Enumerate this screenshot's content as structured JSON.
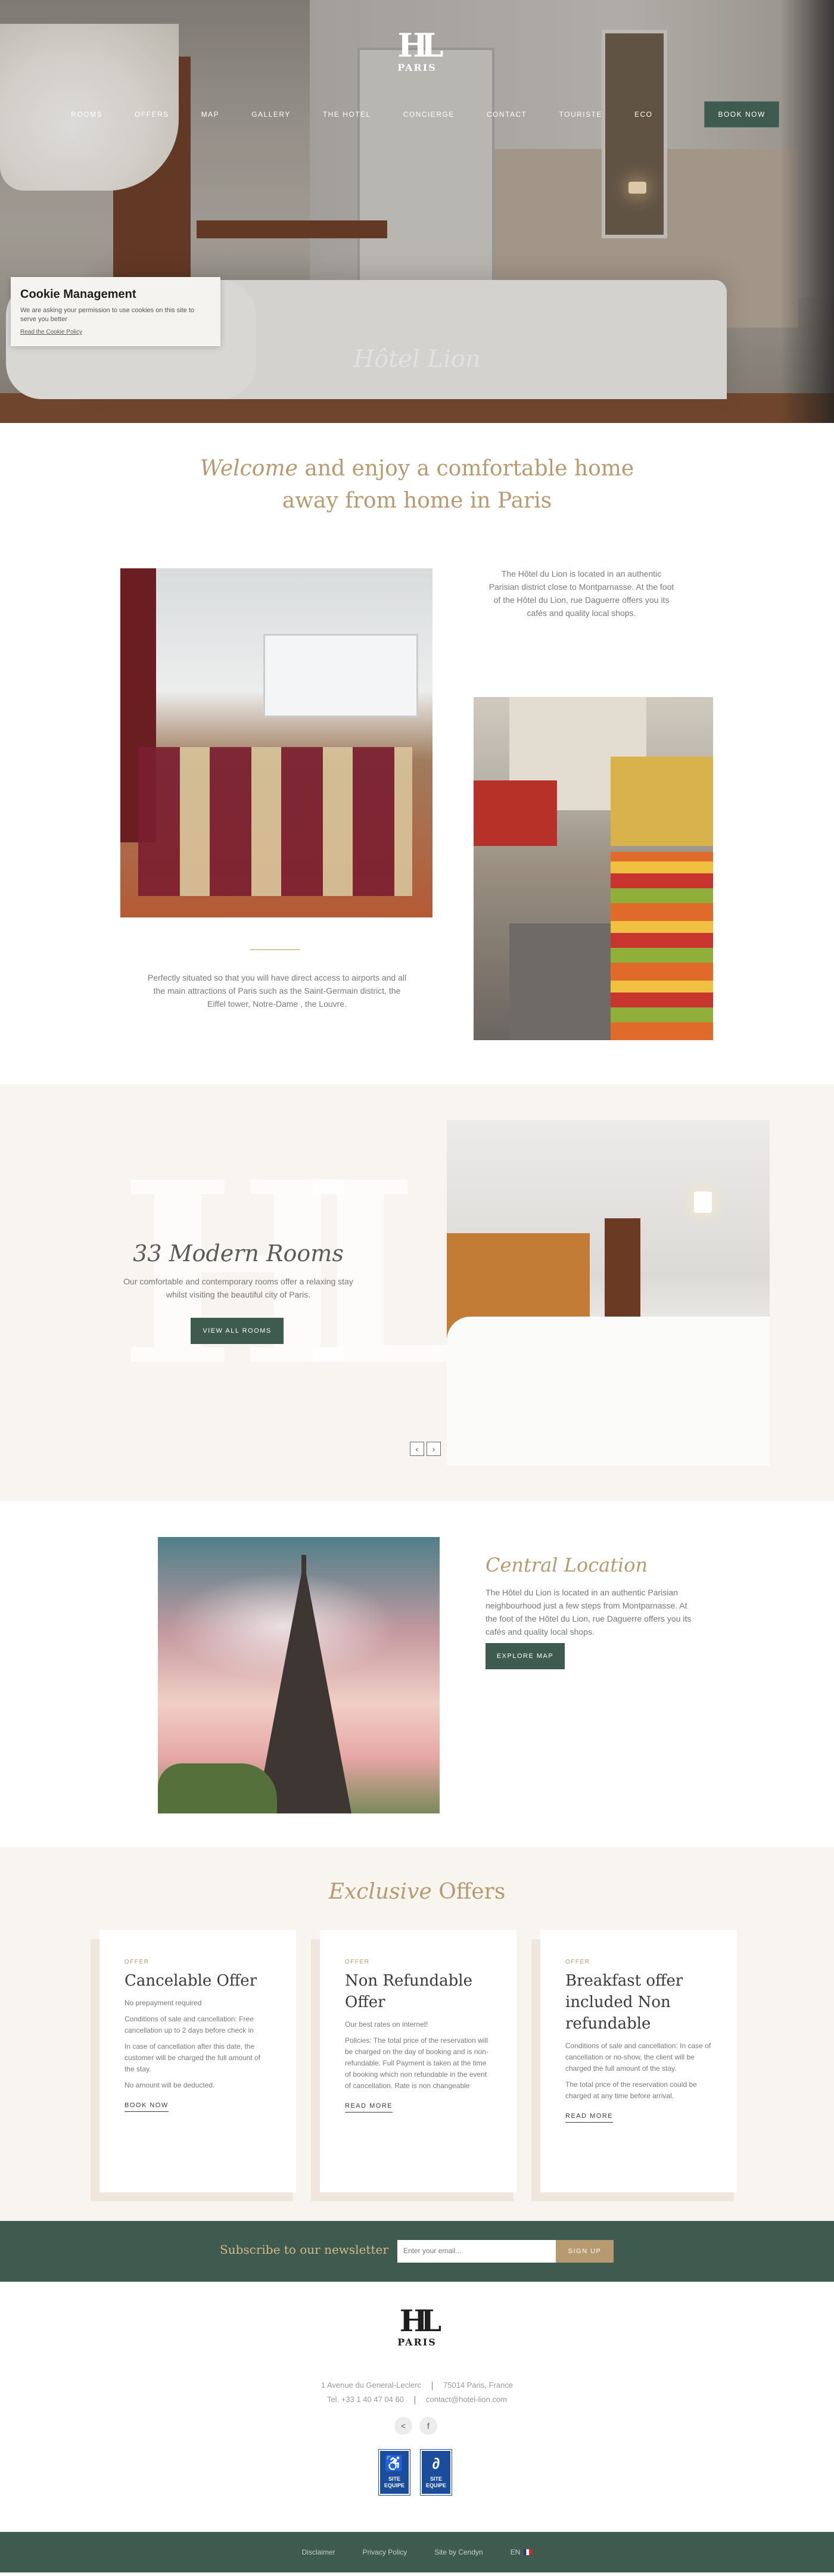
{
  "header": {
    "logo": {
      "mark": "HL",
      "city": "PARIS"
    },
    "nav": [
      "ROOMS",
      "OFFERS",
      "MAP",
      "GALLERY",
      "THE HOTEL",
      "CONCIERGE",
      "CONTACT",
      "TOURISTE",
      "ECO"
    ],
    "book_now": "BOOK NOW",
    "hero_title": "Hôtel Lion"
  },
  "cookie": {
    "title": "Cookie Management",
    "text": "We are asking your permission to use cookies on this site to serve you better",
    "link": "Read the Cookie Policy"
  },
  "welcome": {
    "italic": "Welcome",
    "rest_line1": " and enjoy a comfortable home",
    "line2": "away from home in Paris"
  },
  "intro": {
    "text1": "The Hôtel du Lion is located in an authentic Parisian district close to Montparnasse. At the foot of the Hôtel du Lion, rue Daguerre offers you its cafés and quality local shops.",
    "text2": "Perfectly situated so that you will have direct access to airports and all the main attractions of Paris such as the Saint-Germain district, the Eiffel tower, Notre-Dame , the Louvre."
  },
  "rooms": {
    "title": "33 Modern Rooms",
    "text": "Our comfortable and contemporary rooms offer a relaxing stay whilst visiting the beautiful city of Paris.",
    "button": "VIEW ALL ROOMS",
    "prev": "‹",
    "next": "›",
    "watermark": "HL"
  },
  "location": {
    "title": "Central Location",
    "text": "The Hôtel du Lion is located in an authentic Parisian neighbourhood just a few steps from Montparnasse. At the foot of the Hôtel du Lion, rue Daguerre offers you its cafés and quality local shops.",
    "button": "EXPLORE MAP"
  },
  "offers": {
    "title_italic": "Exclusive",
    "title_rest": " Offers",
    "items": [
      {
        "tag": "OFFER",
        "title": "Cancelable Offer",
        "paragraphs": [
          "No prepayment required",
          "Conditions of sale and cancellation: Free cancellation up to 2 days before check in",
          "In case of cancellation after this date, the customer will be charged the full amount of the stay.",
          "No amount will be deducted."
        ],
        "link": "BOOK NOW"
      },
      {
        "tag": "OFFER",
        "title": "Non Refundable Offer",
        "paragraphs": [
          "Our best rates on internet!",
          "Policies: The total price of the reservation will be charged on the day of booking and is non-refundable. Full Payment is taken at the time of booking which non refundable in the event of cancellation. Rate is non changeable"
        ],
        "link": "READ MORE"
      },
      {
        "tag": "OFFER",
        "title": "Breakfast offer included Non refundable",
        "paragraphs": [
          "Conditions of sale and cancellation: In case of cancellation or no-show, the client will be charged the full amount of the stay.",
          "The total price of the reservation could be charged at any time before arrival."
        ],
        "link": "READ MORE"
      }
    ]
  },
  "newsletter": {
    "label": "Subscribe to our newsletter",
    "placeholder": "Enter your email...",
    "button": "SIGN UP"
  },
  "footer": {
    "address": "1 Avenue du General-Leclerc",
    "postcode": "75014 Paris, France",
    "tel": "Tel. +33 1 40 47 04 60",
    "email": "contact@hotel-lion.com",
    "badges": [
      {
        "label": "SITE EQUIPE",
        "icon": "wheelchair-icon"
      },
      {
        "label": "SITE EQUIPE",
        "icon": "hearing-icon"
      }
    ]
  },
  "bottom": {
    "links": [
      "Disclaimer",
      "Privacy Policy",
      "Site by Cendyn"
    ],
    "lang": "EN"
  },
  "colors": {
    "brand_green": "#3f5a4f",
    "gold": "#b89a70",
    "cream": "#f8f4ef"
  }
}
